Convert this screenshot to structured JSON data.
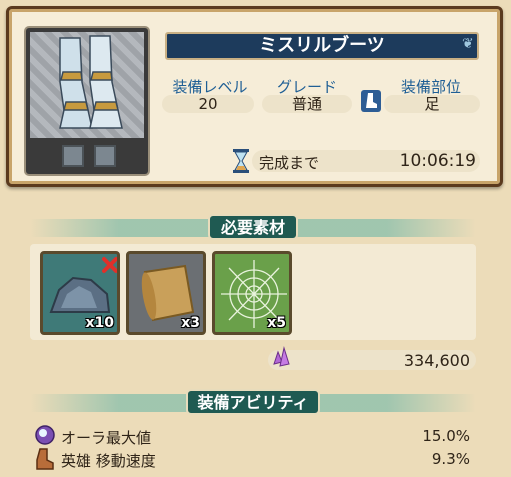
{
  "item": {
    "name": "ミスリルブーツ",
    "stats": [
      {
        "label": "装備レベル",
        "value": "20"
      },
      {
        "label": "グレード",
        "value": "普通"
      },
      {
        "label": "装備部位",
        "value": "足"
      }
    ],
    "timer_label": "完成まで",
    "timer_value": "10:06:19"
  },
  "materials_section": {
    "title": "必要素材",
    "items": [
      {
        "icon": "ore-rock-icon",
        "count": "x10",
        "insufficient": true
      },
      {
        "icon": "scroll-parchment-icon",
        "count": "x3"
      },
      {
        "icon": "spider-web-icon",
        "count": "x5"
      }
    ],
    "cost": "334,600",
    "cost_icon": "purple-crystal-icon"
  },
  "abilities_section": {
    "title": "装備アビリティ",
    "items": [
      {
        "icon": "aura-orb-icon",
        "label": "オーラ最大値",
        "value": "15.0%"
      },
      {
        "icon": "boot-icon",
        "label": "英雄 移動速度",
        "value": "9.3%"
      }
    ]
  },
  "colors": {
    "banner": "#1d3b5c",
    "section_tab": "#1f5a52",
    "stat_label": "#1f5f95",
    "background": "#ecdcb9"
  }
}
